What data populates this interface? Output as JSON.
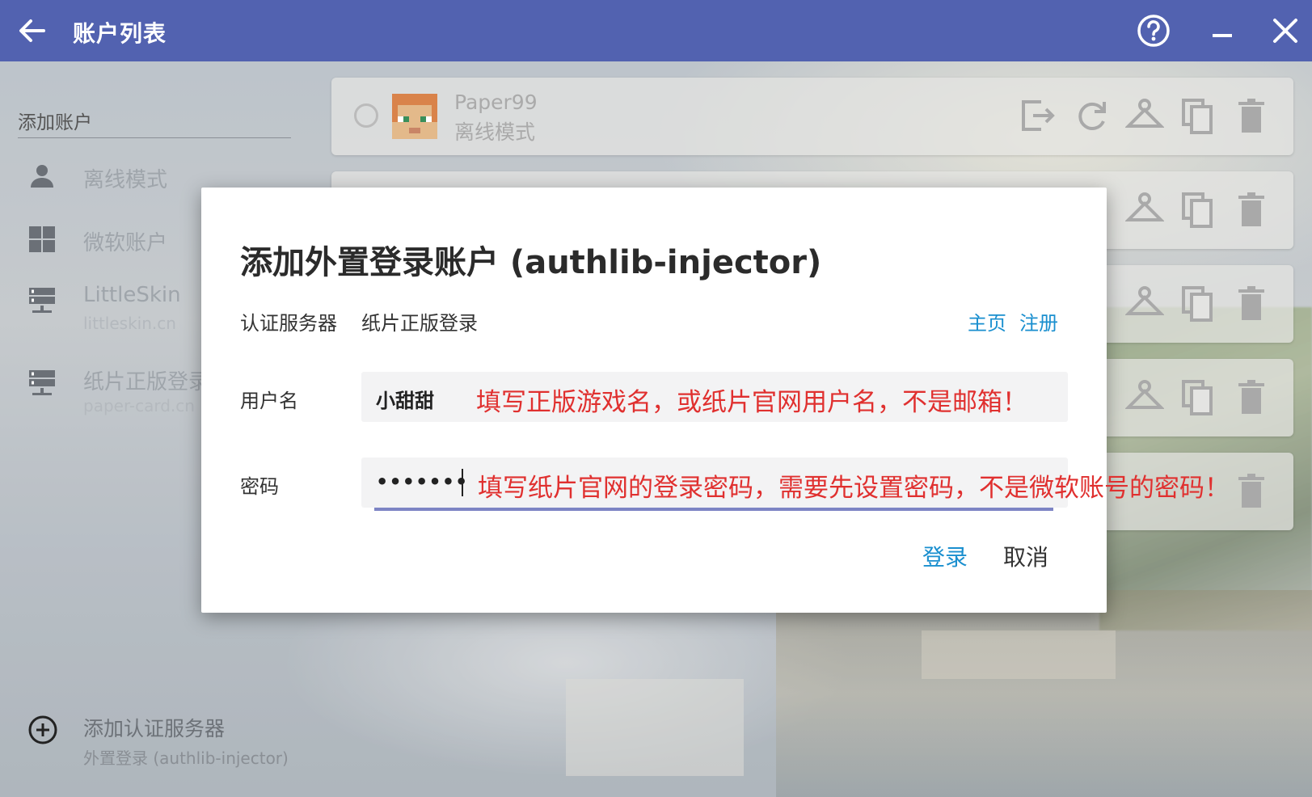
{
  "titlebar": {
    "title": "账户列表",
    "back_icon": "arrow-left-icon",
    "help_icon": "help-circle-icon",
    "minimize_icon": "minimize-icon",
    "close_icon": "close-icon",
    "color": "#5262b0"
  },
  "sidebar": {
    "section_label": "添加账户",
    "items": [
      {
        "label": "离线模式",
        "sub": "",
        "icon": "person-icon"
      },
      {
        "label": "微软账户",
        "sub": "",
        "icon": "windows-icon"
      },
      {
        "label": "LittleSkin",
        "sub": "littleskin.cn",
        "icon": "server-icon"
      },
      {
        "label": "纸片正版登录",
        "sub": "paper-card.cn",
        "icon": "server-icon"
      }
    ],
    "add_server": {
      "label": "添加认证服务器",
      "sub": "外置登录 (authlib-injector)",
      "icon": "add-circle-icon"
    }
  },
  "accounts": [
    {
      "name": "Paper99",
      "mode": "离线模式"
    }
  ],
  "dialog": {
    "title": "添加外置登录账户 (authlib-injector)",
    "server_label": "认证服务器",
    "server_value": "纸片正版登录",
    "homepage_link": "主页",
    "register_link": "注册",
    "username_label": "用户名",
    "username_value": "小甜甜",
    "username_hint": "填写正版游戏名，或纸片官网用户名，不是邮箱！",
    "password_label": "密码",
    "password_value": "•••••••",
    "password_hint": "填写纸片官网的登录密码，需要先设置密码，不是微软账号的密码！",
    "login_button": "登录",
    "cancel_button": "取消",
    "accent_color": "#1a8fcf",
    "hint_color": "#e0302f"
  }
}
